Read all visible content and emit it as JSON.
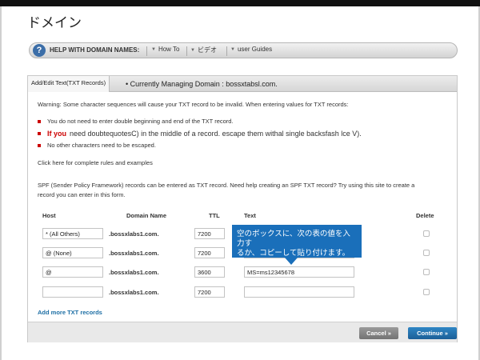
{
  "page": {
    "title": "ドメイン"
  },
  "help": {
    "title": "HELP WITH DOMAIN NAMES:",
    "links": [
      "How To",
      "ビデオ",
      "user Guides"
    ]
  },
  "panel": {
    "tab": "Add/Edit Text(TXT Records)",
    "managing": "Currently Managing Domain : bossxtabsl.com.",
    "warning": "Warning: Some character sequences will cause your TXT record to be invalid. When entering values for TXT records:",
    "bullets": [
      {
        "prefix": "",
        "text": "You do not need to enter double beginning and end of the TXT record."
      },
      {
        "prefix": "If you",
        "text": "need doubtequotesC) in the middle of a record. escape them withal single backsfash lce V)."
      },
      {
        "prefix": "",
        "text": "No other characters need to be escaped."
      }
    ],
    "rules_link": "Click here for complete rules and examples",
    "spf": "SPF (Sender Policy Framework) records can be entered as TXT record. Need help creating an SPF TXT record? Try using this site to create a record you can enter in this form."
  },
  "table": {
    "headers": {
      "host": "Host",
      "domain": "Domain Name",
      "ttl": "TTL",
      "text": "Text",
      "delete": "Delete"
    },
    "rows": [
      {
        "host": "* (All Others)",
        "domain": ".bossxlabs1.com.",
        "ttl": "7200",
        "text": ""
      },
      {
        "host": "@ (None)",
        "domain": ".bossxlabs1.com.",
        "ttl": "7200",
        "text": ""
      },
      {
        "host": "@",
        "domain": ".bossxlabs1.com.",
        "ttl": "3600",
        "text": "MS=ms12345678"
      },
      {
        "host": "",
        "domain": ".bossxlabs1.com.",
        "ttl": "7200",
        "text": ""
      }
    ]
  },
  "callout": {
    "line1": "空のボックスに、次の表の値を入力す",
    "line2": "るか、コピーして貼り付けます。"
  },
  "add_more": "Add more TXT records",
  "buttons": {
    "cancel": "Cancel »",
    "continue": "Continue »"
  },
  "colors": {
    "accent": "#1a6fba",
    "link": "#1d6fa5",
    "warning": "#cc0000"
  }
}
